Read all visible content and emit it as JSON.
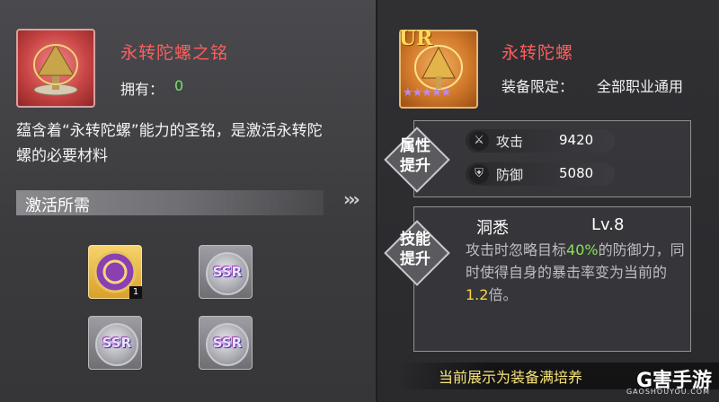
{
  "left": {
    "item_name": "永转陀螺之铭",
    "owned_label": "拥有：",
    "owned_value": "0",
    "description": "蕴含着“永转陀螺”能力的圣铭，是激活永转陀螺的必要材料",
    "section_title": "激活所需",
    "slots": [
      {
        "kind": "gold",
        "count": "1"
      },
      {
        "kind": "ssr",
        "label": "SSR"
      },
      {
        "kind": "ssr",
        "label": "SSR"
      },
      {
        "kind": "ssr",
        "label": "SSR"
      }
    ]
  },
  "right": {
    "rarity": "UR",
    "stars": "★★★★★",
    "item_name": "永转陀螺",
    "equip_limit_label": "装备限定：",
    "equip_limit_value": "全部职业通用",
    "attr_section": "属性\n提升",
    "stats": [
      {
        "label": "攻击",
        "value": "9420",
        "icon": "swords-icon"
      },
      {
        "label": "防御",
        "value": "5080",
        "icon": "shield-icon"
      }
    ],
    "skill_section": "技能\n提升",
    "skill_name": "洞悉",
    "skill_level": "Lv.8",
    "skill_desc_1": "攻击时忽略目标",
    "skill_desc_pct": "40%",
    "skill_desc_2": "的防御力，同时使得自身的暴击率变为当前的",
    "skill_desc_mult": "1.2",
    "skill_desc_3": "倍。"
  },
  "footer": {
    "note": "当前展示为装备满培养",
    "watermark": "G害手游",
    "watermark_sub": "GAOSHOUYOU.COM"
  }
}
